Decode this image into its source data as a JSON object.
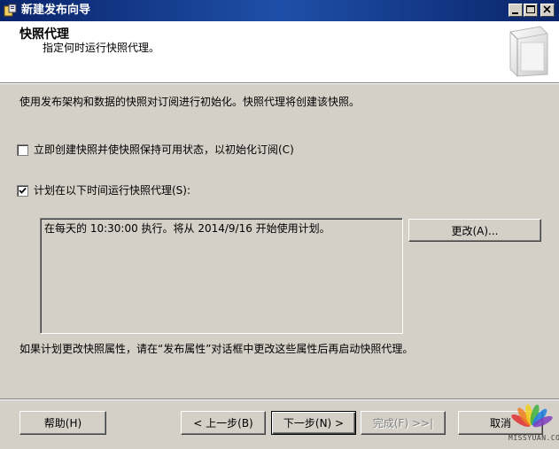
{
  "window": {
    "title": "新建发布向导"
  },
  "header": {
    "title": "快照代理",
    "subtitle": "指定何时运行快照代理。"
  },
  "body": {
    "intro": "使用发布架构和数据的快照对订阅进行初始化。快照代理将创建该快照。",
    "option_immediate": {
      "label": "立即创建快照并使快照保持可用状态，以初始化订阅(C)",
      "checked": false
    },
    "option_schedule": {
      "label": "计划在以下时间运行快照代理(S):",
      "checked": true
    },
    "schedule_description": "在每天的 10:30:00 执行。将从 2014/9/16 开始使用计划。",
    "change_button": "更改(A)...",
    "footnote": "如果计划更改快照属性，请在“发布属性”对话框中更改这些属性后再启动快照代理。"
  },
  "footer": {
    "help": "帮助(H)",
    "back": "< 上一步(B)",
    "next": "下一步(N) >",
    "finish": "完成(F) >>|",
    "cancel": "取消"
  },
  "watermark": {
    "text": "MISSYUAN.COM"
  },
  "colors": {
    "titlebar": "#0a246a",
    "face": "#d4d0c8",
    "header_bg": "#ffffff",
    "disabled_text": "#808080"
  }
}
